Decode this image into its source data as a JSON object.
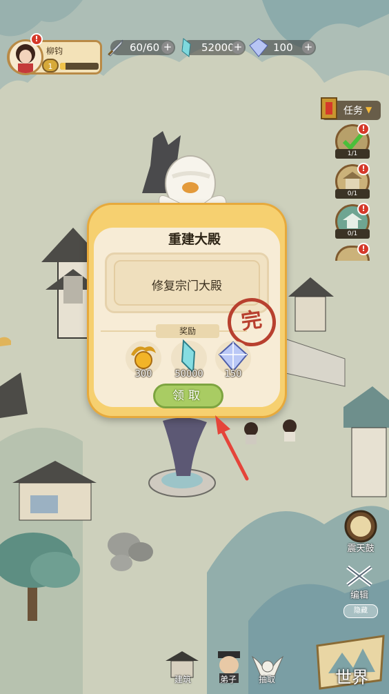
{
  "player": {
    "name": "柳钧",
    "level": "1",
    "exp_fraction": 0.15
  },
  "resources": [
    {
      "name": "stamina",
      "value": "60/60",
      "icon": "sword-icon"
    },
    {
      "name": "spirit-stone",
      "value": "52000",
      "icon": "crystal-icon"
    },
    {
      "name": "gem",
      "value": "100",
      "icon": "gem-icon"
    }
  ],
  "quests": {
    "header_label": "任务",
    "slots": [
      {
        "count": "1/1",
        "done": true
      },
      {
        "count": "0/1",
        "done": false
      },
      {
        "count": "0/1",
        "done": false
      }
    ]
  },
  "side_buttons": {
    "drum_label": "震天鼓",
    "edit_label": "编辑",
    "toggle_label": "隐藏"
  },
  "bottom_nav": {
    "build_label": "建筑",
    "disciple_label": "弟子",
    "draw_label": "抽取",
    "world_label": "世界"
  },
  "dialog": {
    "title": "重建大殿",
    "task_name": "修复宗门大殿",
    "reward_label": "奖励",
    "rewards": [
      {
        "amount": "300",
        "icon": "gold-dragon-icon"
      },
      {
        "amount": "50000",
        "icon": "crystal-icon"
      },
      {
        "amount": "150",
        "icon": "gem-icon"
      }
    ],
    "stamp_text": "完",
    "claim_label": "领取"
  },
  "colors": {
    "dialog_bg": "#f6d070",
    "claim_green": "#a9cc63",
    "stamp_red": "#b8402f",
    "alert_red": "#d5392a"
  }
}
